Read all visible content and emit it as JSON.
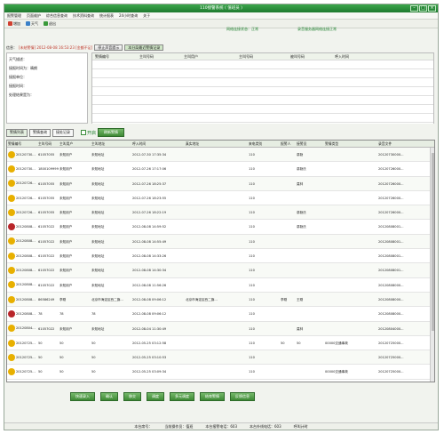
{
  "window": {
    "title": "110接警系统 ( 值班员 )"
  },
  "menu": [
    "报警管理",
    "页面维护",
    "综合信息查询",
    "技术资料查询",
    "统计报表",
    "24小时查询",
    "关于"
  ],
  "toolbar": [
    {
      "label": "增加",
      "icon": "add-icon",
      "color": "#d04030"
    },
    {
      "label": "天气",
      "icon": "weather-icon",
      "color": "#3a80c8"
    },
    {
      "label": "退出",
      "icon": "exit-icon",
      "color": "#3a9a3a"
    }
  ],
  "network": {
    "status": "网络连接状态：正常",
    "server": "录音服务器网络连接正常"
  },
  "info": {
    "label": "信息：",
    "alarm_text": "[未结警情] 2012-08-08 16:53:23 [金额不足]",
    "stop_button": "停止声音提示",
    "history_button": "本分局最近警情记录",
    "fields": [
      "天气描述：",
      "接报时间为：晴朗",
      "接报单位：",
      "接报时间：",
      "处理结果是为："
    ],
    "top_headers": [
      "警情编号",
      "主叫号码",
      "主叫用户",
      "主叫号码",
      "被叫号码",
      "呼入时间"
    ]
  },
  "tabs": [
    "警情列表",
    "警情查询",
    "接处记录"
  ],
  "checkbox_label": "开启",
  "refresh_button": "刷新警情",
  "columns": [
    "警情编号",
    "主叫号码",
    "主叫用户",
    "主叫地址",
    "呼入时间",
    "真实地址",
    "来电类别",
    "报警人",
    "接警员",
    "警情类型",
    "录音文件"
  ],
  "rows": [
    {
      "icon": "#e8b000",
      "cells": [
        "20120730...",
        "61057055",
        "未知用户",
        "未知地址",
        "2012-07-30 17:35:34",
        "",
        "110",
        "",
        "慕勤",
        "",
        "20120730000..."
      ]
    },
    {
      "icon": "#e8b000",
      "cells": [
        "20120730...",
        "18001099999",
        "未知用户",
        "未知地址",
        "2012-07-26 17:17:06",
        "",
        "110",
        "",
        "慕勤氏",
        "",
        "20120726000..."
      ]
    },
    {
      "icon": "#e8b000",
      "cells": [
        "20120726...",
        "61057055",
        "未知用户",
        "未知地址",
        "2012-07-26 18:25:37",
        "",
        "110",
        "",
        "莫林",
        "",
        "20120726000..."
      ]
    },
    {
      "icon": "#e8b000",
      "cells": [
        "20120726...",
        "61057055",
        "未知用户",
        "未知地址",
        "2012-07-26 18:23:55",
        "",
        "110",
        "",
        "",
        "",
        "20120726000..."
      ]
    },
    {
      "icon": "#e8b000",
      "cells": [
        "20120726...",
        "61057055",
        "未知用户",
        "未知地址",
        "2012-07-26 18:22:19",
        "",
        "110",
        "",
        "慕勤氏",
        "",
        "20120726000..."
      ]
    },
    {
      "icon": "#b8262a",
      "cells": [
        "20120808...",
        "61057022",
        "未知用户",
        "未知地址",
        "2012-08-08 14:59:52",
        "",
        "110",
        "",
        "慕勤氏",
        "",
        "20120808001..."
      ]
    },
    {
      "icon": "#e8b000",
      "cells": [
        "20120808...",
        "61057022",
        "未知用户",
        "未知地址",
        "2012-08-08 14:55:49",
        "",
        "110",
        "",
        "",
        "",
        "20120808001..."
      ]
    },
    {
      "icon": "#e8b000",
      "cells": [
        "20120808...",
        "61057022",
        "未知用户",
        "未知地址",
        "2012-08-08 14:33:26",
        "",
        "110",
        "",
        "",
        "",
        "20120808001..."
      ]
    },
    {
      "icon": "#e8b000",
      "cells": [
        "20120808...",
        "61057022",
        "未知用户",
        "未知地址",
        "2012-08-08 14:30:34",
        "",
        "110",
        "",
        "",
        "",
        "20120808001..."
      ]
    },
    {
      "icon": "#e8b000",
      "cells": [
        "20120808...",
        "61057022",
        "未知用户",
        "未知地址",
        "2012-08-08 11:56:26",
        "",
        "110",
        "",
        "",
        "",
        "20120808000..."
      ]
    },
    {
      "icon": "#e8b000",
      "cells": [
        "20120808...",
        "86586249",
        "李刚",
        "北京市海淀区西二旗...",
        "2012-08-08 09:06:12",
        "北京市海淀区西二旗...",
        "110",
        "李刚",
        "王刚",
        "",
        "20120808000..."
      ]
    },
    {
      "icon": "#b8262a",
      "cells": [
        "20120808...",
        "78",
        "78",
        "78",
        "2012-08-08 09:06:12",
        "",
        "110",
        "",
        "",
        "",
        "20120808000..."
      ]
    },
    {
      "icon": "#e8b000",
      "cells": [
        "20120804...",
        "61057022",
        "未知用户",
        "未知地址",
        "2012-08-04 11:30:49",
        "",
        "110",
        "",
        "莫林",
        "",
        "20120804000..."
      ]
    },
    {
      "icon": "#e8b000",
      "cells": [
        "20120725...",
        "50",
        "50",
        "50",
        "2012-05-25 03:12:58",
        "",
        "110",
        "50",
        "50",
        "00000交通事故",
        "20120725000..."
      ]
    },
    {
      "icon": "#e8b000",
      "cells": [
        "20120725...",
        "50",
        "50",
        "50",
        "2012-05-25 03:10:53",
        "",
        "110",
        "",
        "",
        "",
        "20120725000..."
      ]
    },
    {
      "icon": "#e8b000",
      "cells": [
        "20120725...",
        "50",
        "50",
        "50",
        "2012-05-25 03:09:34",
        "",
        "110",
        "",
        "",
        "00000交通事故",
        "20120725000..."
      ]
    }
  ],
  "actions": [
    "快速录入",
    "确认",
    "移交",
    "调度",
    "多元调度",
    "结束警情",
    "反馈信息"
  ],
  "status": [
    "本台席号：",
    "当前操作员：值班",
    "本台报警电话：603",
    "本台外线电话：603",
    "呼叫计时"
  ]
}
